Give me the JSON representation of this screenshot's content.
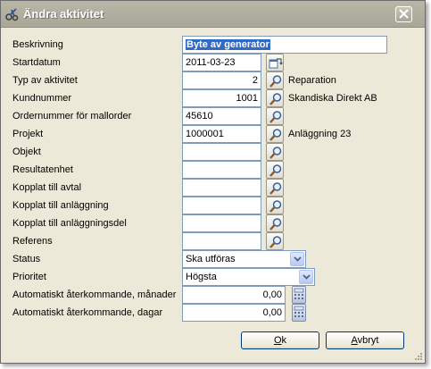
{
  "window": {
    "title": "Ändra aktivitet"
  },
  "form": {
    "rows": [
      {
        "label": "Beskrivning",
        "value": "Byte av generator",
        "kind": "text-selected"
      },
      {
        "label": "Startdatum",
        "value": "2011-03-23",
        "kind": "text"
      },
      {
        "label": "Typ av aktivitet",
        "value": "2",
        "kind": "num",
        "after": "Reparation"
      },
      {
        "label": "Kundnummer",
        "value": "1001",
        "kind": "num",
        "after": "Skandiska Direkt AB"
      },
      {
        "label": "Ordernummer för mallorder",
        "value": "45610",
        "kind": "text"
      },
      {
        "label": "Projekt",
        "value": "1000001",
        "kind": "text",
        "after": "Anläggning 23"
      },
      {
        "label": "Objekt",
        "value": "",
        "kind": "text"
      },
      {
        "label": "Resultatenhet",
        "value": "",
        "kind": "text"
      },
      {
        "label": "Kopplat till avtal",
        "value": "",
        "kind": "text"
      },
      {
        "label": "Kopplat till anläggning",
        "value": "",
        "kind": "text"
      },
      {
        "label": "Kopplat till anläggningsdel",
        "value": "",
        "kind": "text"
      },
      {
        "label": "Referens",
        "value": "",
        "kind": "text"
      },
      {
        "label": "Status",
        "value": "Ska utföras",
        "kind": "combo"
      },
      {
        "label": "Prioritet",
        "value": "Högsta",
        "kind": "combo"
      },
      {
        "label": "Automatiskt återkommande, månader",
        "value": "0,00",
        "kind": "calc"
      },
      {
        "label": "Automatiskt återkommande, dagar",
        "value": "0,00",
        "kind": "calc"
      }
    ]
  },
  "buttons": {
    "ok_label": "Ok",
    "ok_mnemonic": "O",
    "cancel_label": "Avbryt",
    "cancel_mnemonic": "A"
  },
  "colors": {
    "selection": "#316ac5",
    "titlebar": "#aaa898",
    "dialog_bg": "#ece9d8",
    "field_border": "#7f9db9"
  }
}
